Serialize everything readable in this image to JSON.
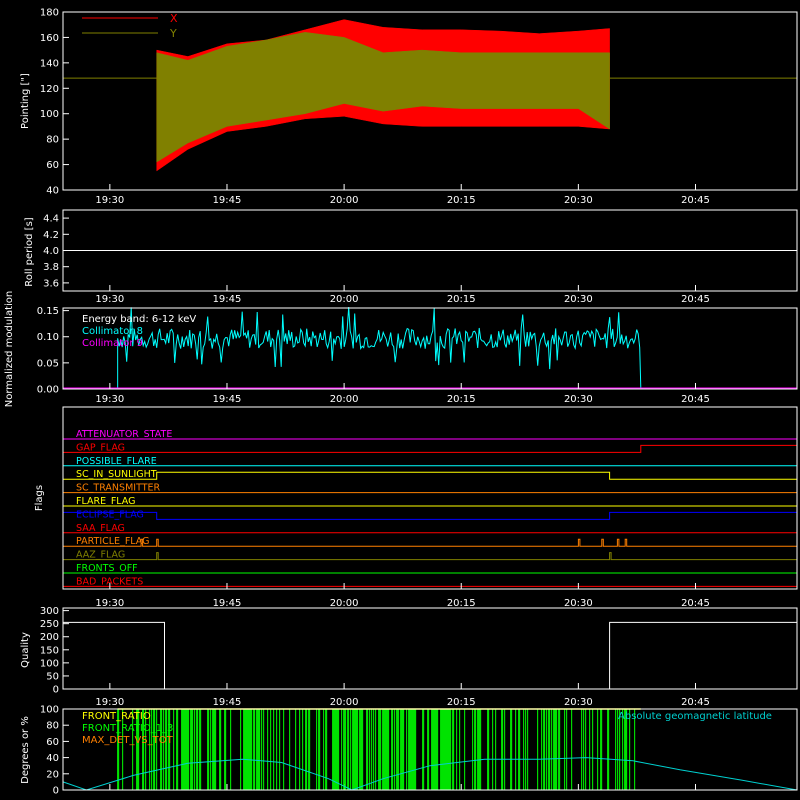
{
  "colors": {
    "background": "#000000",
    "axes": "#ffffff",
    "x_series": "#ff0000",
    "y_series": "#808000",
    "collimator8": "#00ffff",
    "collimator9": "#ff00ff",
    "front_ratio": "#ffff00",
    "front_ratio_fill": "#00ff00",
    "max_det": "#ff8000",
    "geomag": "#00d0d0"
  },
  "time_ticks": [
    "19:30",
    "19:45",
    "20:00",
    "20:15",
    "20:30",
    "20:45"
  ],
  "chart_data": [
    {
      "id": "pointing",
      "type": "area",
      "ylabel": "Pointing [\"]",
      "ylim": [
        40,
        180
      ],
      "yticks": [
        "40",
        "60",
        "80",
        "100",
        "120",
        "140",
        "160",
        "180"
      ],
      "legend": [
        "X",
        "Y"
      ],
      "legend_position": "top-left",
      "x_range_minutes": [
        1157,
        1258
      ],
      "data_start": "19:36",
      "data_end": "20:34",
      "baseline": 128,
      "series": [
        {
          "name": "X",
          "color": "#ff0000",
          "x": [
            "19:36",
            "19:40",
            "19:45",
            "19:50",
            "19:55",
            "20:00",
            "20:05",
            "20:10",
            "20:15",
            "20:20",
            "20:25",
            "20:30",
            "20:34"
          ],
          "upper": [
            150,
            145,
            155,
            158,
            166,
            174,
            168,
            166,
            166,
            165,
            163,
            165,
            167
          ],
          "lower": [
            55,
            72,
            86,
            90,
            96,
            98,
            92,
            90,
            90,
            90,
            90,
            90,
            88
          ]
        },
        {
          "name": "Y",
          "color": "#808000",
          "x": [
            "19:36",
            "19:40",
            "19:45",
            "19:50",
            "19:55",
            "20:00",
            "20:05",
            "20:10",
            "20:15",
            "20:20",
            "20:25",
            "20:30",
            "20:34"
          ],
          "upper": [
            148,
            142,
            153,
            158,
            164,
            160,
            148,
            150,
            148,
            148,
            148,
            148,
            148
          ],
          "lower": [
            62,
            77,
            90,
            95,
            100,
            108,
            102,
            106,
            104,
            104,
            104,
            104,
            88
          ]
        }
      ]
    },
    {
      "id": "roll",
      "type": "line",
      "ylabel": "Roll period [s]",
      "ylim": [
        3.5,
        4.5
      ],
      "yticks": [
        "3.6",
        "3.8",
        "4.0",
        "4.2",
        "4.4"
      ],
      "series": [
        {
          "x": [
            "19:24",
            "20:58"
          ],
          "values": [
            4.0,
            4.0
          ],
          "color": "#ffffff"
        }
      ]
    },
    {
      "id": "modulation",
      "type": "line",
      "ylabel": "Normalized modulation",
      "ylim": [
        0,
        0.155
      ],
      "yticks": [
        "0.00",
        "0.05",
        "0.10",
        "0.15"
      ],
      "annotations": [
        "Energy band: 6-12 keV",
        "Collimator 8",
        "Collimator 9"
      ],
      "series": [
        {
          "name": "Collimator 8",
          "color": "#00ffff",
          "start": "19:31",
          "end": "20:38",
          "mean": 0.097,
          "spread": 0.02
        },
        {
          "name": "Collimator 9",
          "color": "#ff00ff",
          "values": [
            0.0,
            0.0
          ]
        }
      ]
    },
    {
      "id": "flags",
      "type": "step",
      "ylabel": "Flags",
      "flags": [
        {
          "name": "ATTENUATOR_STATE",
          "color": "#ff00ff",
          "steps": []
        },
        {
          "name": "GAP_FLAG",
          "color": "#ff0000",
          "steps": [
            [
              "20:38",
              1
            ]
          ]
        },
        {
          "name": "POSSIBLE_FLARE",
          "color": "#00ffff",
          "steps": []
        },
        {
          "name": "SC_IN_SUNLIGHT",
          "color": "#ffff00",
          "steps": [
            [
              "19:36",
              1
            ],
            [
              "20:34",
              0
            ]
          ]
        },
        {
          "name": "SC_TRANSMITTER",
          "color": "#ff8000",
          "steps": []
        },
        {
          "name": "FLARE_FLAG",
          "color": "#ffff00",
          "steps": []
        },
        {
          "name": "ECLIPSE_FLAG",
          "color": "#0000ff",
          "steps": [
            [
              "19:36",
              0
            ],
            [
              "20:34",
              1
            ]
          ]
        },
        {
          "name": "SAA_FLAG",
          "color": "#ff0000",
          "steps": []
        },
        {
          "name": "PARTICLE_FLAG",
          "color": "#ff8000",
          "pulses": [
            "19:34",
            "19:36",
            "20:30",
            "20:33",
            "20:35",
            "20:36"
          ]
        },
        {
          "name": "AAZ_FLAG",
          "color": "#808000",
          "pulses": [
            "19:36",
            "20:34"
          ]
        },
        {
          "name": "FRONTS_OFF",
          "color": "#00ff00",
          "steps": []
        },
        {
          "name": "BAD_PACKETS",
          "color": "#ff0000",
          "steps": []
        }
      ]
    },
    {
      "id": "quality",
      "type": "step",
      "ylabel": "Quality",
      "ylim": [
        0,
        310
      ],
      "yticks": [
        "0",
        "50",
        "100",
        "150",
        "200",
        "250",
        "300"
      ],
      "series": [
        {
          "x": [
            "19:24",
            "19:37",
            "19:37",
            "20:34",
            "20:34",
            "20:58"
          ],
          "values": [
            255,
            255,
            0,
            0,
            255,
            255
          ],
          "color": "#ffffff"
        }
      ]
    },
    {
      "id": "ratios",
      "type": "line",
      "ylabel": "Degrees or %",
      "ylim": [
        0,
        100
      ],
      "yticks": [
        "0",
        "20",
        "40",
        "60",
        "80",
        "100"
      ],
      "legend": [
        "FRONT_RATIO",
        "FRONT_RATIO_1_3",
        "MAX_DET_VS_TOT"
      ],
      "annotation": "Absolute geomagnetic latitude",
      "geomag": {
        "x": [
          "19:24",
          "19:27",
          "19:33",
          "19:40",
          "19:47",
          "19:52",
          "19:58",
          "20:01",
          "20:05",
          "20:11",
          "20:18",
          "20:25",
          "20:31",
          "20:37",
          "20:43",
          "20:51",
          "20:58"
        ],
        "values": [
          10,
          0,
          18,
          33,
          38,
          34,
          14,
          0,
          14,
          30,
          38,
          38,
          40,
          36,
          25,
          12,
          0
        ]
      },
      "front_ratio_start": "19:31",
      "front_ratio_end": "20:38"
    }
  ]
}
